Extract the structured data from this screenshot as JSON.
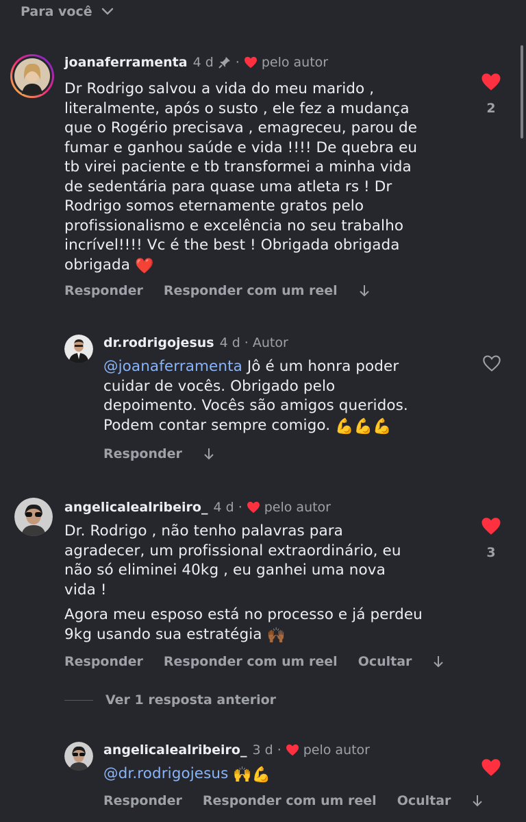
{
  "filter": {
    "label": "Para você"
  },
  "comments": [
    {
      "username": "joanaferramenta",
      "time": "4 d",
      "author_badge": "pelo autor",
      "text_lines": [
        "Dr Rodrigo salvou a vida do meu marido ,",
        "literalmente, após o susto , ele fez a mudança",
        "que o Rogério precisava , emagreceu, parou de",
        "fumar e ganhou saúde e vida !!!! De quebra eu",
        "tb virei paciente e tb transformei a minha vida",
        "de sedentária para quase uma atleta rs ! Dr",
        "Rodrigo somos eternamente gratos pelo",
        "profissionalismo e excelência no seu trabalho",
        "incrível!!!! Vc é the best ! Obrigada obrigada",
        "obrigada"
      ],
      "emoji": "❤️",
      "likes": "2",
      "actions": {
        "reply": "Responder",
        "reply_reel": "Responder com um reel"
      }
    },
    {
      "username": "dr.rodrigojesus",
      "time": "4 d",
      "author_label": "Autor",
      "mention": "@joanaferramenta",
      "text_lines": [
        " Jô é um honra poder",
        "cuidar de vocês. Obrigado pelo",
        "depoimento. Vocês são amigos queridos.",
        "Podem contar sempre comigo. "
      ],
      "emoji": "💪💪💪",
      "actions": {
        "reply": "Responder"
      }
    },
    {
      "username": "angelicalealribeiro_",
      "time": "4 d",
      "author_badge": "pelo autor",
      "text_lines": [
        "Dr. Rodrigo , não tenho palavras para",
        "agradecer, um profissional extraordinário, eu",
        "não só eliminei 40kg , eu ganhei uma nova",
        "vida !"
      ],
      "text_lines_2": [
        "Agora meu esposo está no processo e já perdeu",
        "9kg usando sua estratégia "
      ],
      "emoji": "🙌🏾",
      "likes": "3",
      "actions": {
        "reply": "Responder",
        "reply_reel": "Responder com um reel",
        "hide": "Ocultar"
      }
    },
    {
      "username": "angelicalealribeiro_",
      "time": "3 d",
      "author_badge": "pelo autor",
      "mention": "@dr.rodrigojesus",
      "emoji": "🙌💪",
      "actions": {
        "reply": "Responder",
        "reply_reel": "Responder com um reel",
        "hide": "Ocultar"
      }
    }
  ],
  "view_replies": "Ver 1 resposta anterior",
  "colors": {
    "background": "#25272c",
    "heart": "#ff3040",
    "mention": "#8ab4f8",
    "muted": "#9ea1a8"
  }
}
